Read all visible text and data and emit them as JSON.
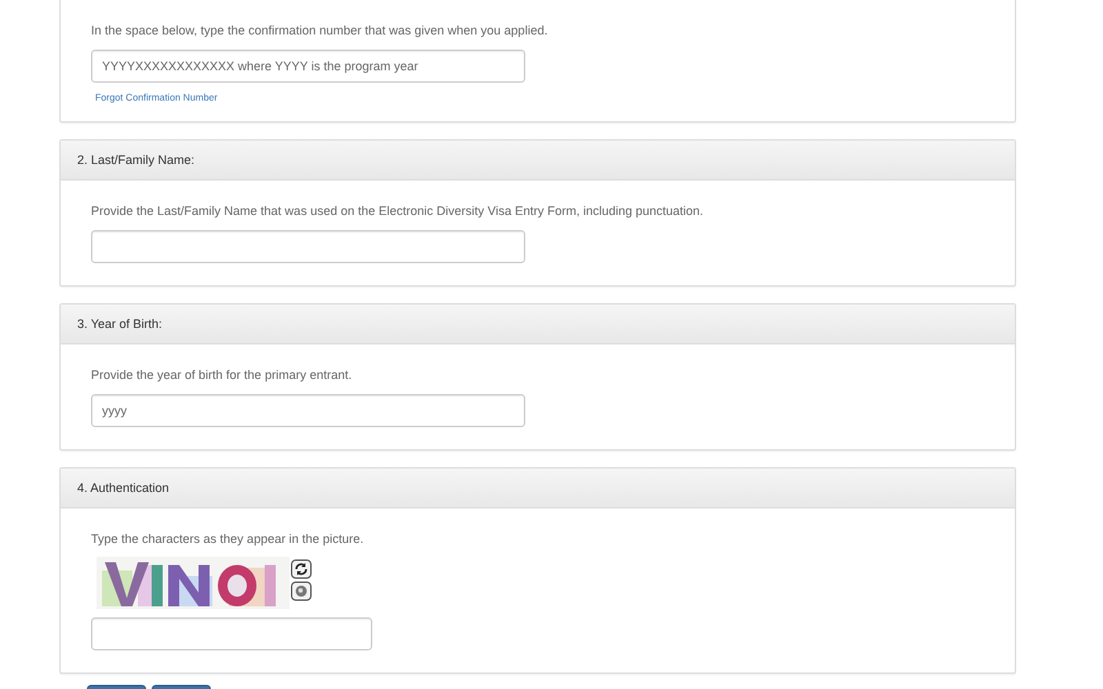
{
  "sections": [
    {
      "instruction": "In the space below, type the confirmation number that was given when you applied.",
      "field": {
        "kind": "text",
        "placeholder": "YYYYXXXXXXXXXXXX where YYYY is the program year"
      },
      "link": "Forgot Confirmation Number"
    },
    {
      "title": "2. Last/Family Name:",
      "instruction": "Provide the Last/Family Name that was used on the Electronic Diversity Visa Entry Form, including punctuation.",
      "field": {
        "kind": "text"
      }
    },
    {
      "title": "3. Year of Birth:",
      "instruction": "Provide the year of birth for the primary entrant.",
      "field": {
        "kind": "text",
        "placeholder": "yyyy"
      }
    },
    {
      "title": "4. Authentication",
      "instruction": "Type the characters as they appear in the picture.",
      "field": {
        "kind": "text"
      }
    }
  ],
  "footer_buttons": [
    {
      "kind": "primary"
    },
    {
      "kind": "primary"
    }
  ]
}
